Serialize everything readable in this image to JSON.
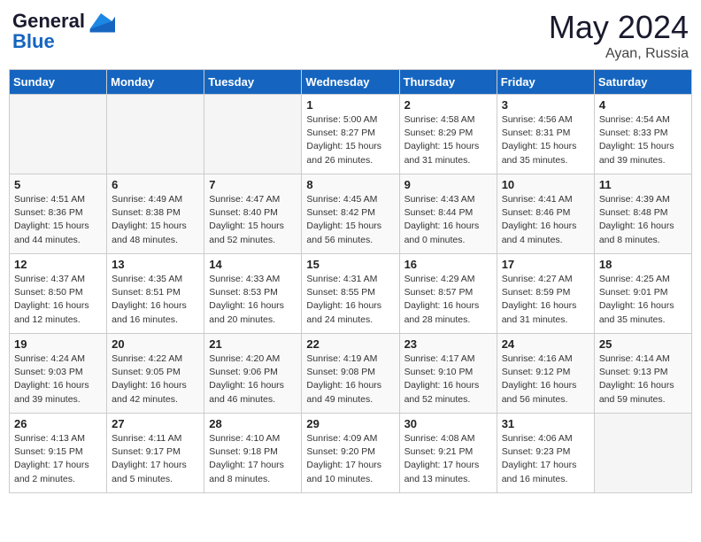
{
  "header": {
    "logo_line1": "General",
    "logo_line2": "Blue",
    "month_year": "May 2024",
    "location": "Ayan, Russia"
  },
  "days_of_week": [
    "Sunday",
    "Monday",
    "Tuesday",
    "Wednesday",
    "Thursday",
    "Friday",
    "Saturday"
  ],
  "weeks": [
    [
      {
        "num": "",
        "sunrise": "",
        "sunset": "",
        "daylight": "",
        "empty": true
      },
      {
        "num": "",
        "sunrise": "",
        "sunset": "",
        "daylight": "",
        "empty": true
      },
      {
        "num": "",
        "sunrise": "",
        "sunset": "",
        "daylight": "",
        "empty": true
      },
      {
        "num": "1",
        "sunrise": "Sunrise: 5:00 AM",
        "sunset": "Sunset: 8:27 PM",
        "daylight": "Daylight: 15 hours and 26 minutes.",
        "empty": false
      },
      {
        "num": "2",
        "sunrise": "Sunrise: 4:58 AM",
        "sunset": "Sunset: 8:29 PM",
        "daylight": "Daylight: 15 hours and 31 minutes.",
        "empty": false
      },
      {
        "num": "3",
        "sunrise": "Sunrise: 4:56 AM",
        "sunset": "Sunset: 8:31 PM",
        "daylight": "Daylight: 15 hours and 35 minutes.",
        "empty": false
      },
      {
        "num": "4",
        "sunrise": "Sunrise: 4:54 AM",
        "sunset": "Sunset: 8:33 PM",
        "daylight": "Daylight: 15 hours and 39 minutes.",
        "empty": false
      }
    ],
    [
      {
        "num": "5",
        "sunrise": "Sunrise: 4:51 AM",
        "sunset": "Sunset: 8:36 PM",
        "daylight": "Daylight: 15 hours and 44 minutes.",
        "empty": false
      },
      {
        "num": "6",
        "sunrise": "Sunrise: 4:49 AM",
        "sunset": "Sunset: 8:38 PM",
        "daylight": "Daylight: 15 hours and 48 minutes.",
        "empty": false
      },
      {
        "num": "7",
        "sunrise": "Sunrise: 4:47 AM",
        "sunset": "Sunset: 8:40 PM",
        "daylight": "Daylight: 15 hours and 52 minutes.",
        "empty": false
      },
      {
        "num": "8",
        "sunrise": "Sunrise: 4:45 AM",
        "sunset": "Sunset: 8:42 PM",
        "daylight": "Daylight: 15 hours and 56 minutes.",
        "empty": false
      },
      {
        "num": "9",
        "sunrise": "Sunrise: 4:43 AM",
        "sunset": "Sunset: 8:44 PM",
        "daylight": "Daylight: 16 hours and 0 minutes.",
        "empty": false
      },
      {
        "num": "10",
        "sunrise": "Sunrise: 4:41 AM",
        "sunset": "Sunset: 8:46 PM",
        "daylight": "Daylight: 16 hours and 4 minutes.",
        "empty": false
      },
      {
        "num": "11",
        "sunrise": "Sunrise: 4:39 AM",
        "sunset": "Sunset: 8:48 PM",
        "daylight": "Daylight: 16 hours and 8 minutes.",
        "empty": false
      }
    ],
    [
      {
        "num": "12",
        "sunrise": "Sunrise: 4:37 AM",
        "sunset": "Sunset: 8:50 PM",
        "daylight": "Daylight: 16 hours and 12 minutes.",
        "empty": false
      },
      {
        "num": "13",
        "sunrise": "Sunrise: 4:35 AM",
        "sunset": "Sunset: 8:51 PM",
        "daylight": "Daylight: 16 hours and 16 minutes.",
        "empty": false
      },
      {
        "num": "14",
        "sunrise": "Sunrise: 4:33 AM",
        "sunset": "Sunset: 8:53 PM",
        "daylight": "Daylight: 16 hours and 20 minutes.",
        "empty": false
      },
      {
        "num": "15",
        "sunrise": "Sunrise: 4:31 AM",
        "sunset": "Sunset: 8:55 PM",
        "daylight": "Daylight: 16 hours and 24 minutes.",
        "empty": false
      },
      {
        "num": "16",
        "sunrise": "Sunrise: 4:29 AM",
        "sunset": "Sunset: 8:57 PM",
        "daylight": "Daylight: 16 hours and 28 minutes.",
        "empty": false
      },
      {
        "num": "17",
        "sunrise": "Sunrise: 4:27 AM",
        "sunset": "Sunset: 8:59 PM",
        "daylight": "Daylight: 16 hours and 31 minutes.",
        "empty": false
      },
      {
        "num": "18",
        "sunrise": "Sunrise: 4:25 AM",
        "sunset": "Sunset: 9:01 PM",
        "daylight": "Daylight: 16 hours and 35 minutes.",
        "empty": false
      }
    ],
    [
      {
        "num": "19",
        "sunrise": "Sunrise: 4:24 AM",
        "sunset": "Sunset: 9:03 PM",
        "daylight": "Daylight: 16 hours and 39 minutes.",
        "empty": false
      },
      {
        "num": "20",
        "sunrise": "Sunrise: 4:22 AM",
        "sunset": "Sunset: 9:05 PM",
        "daylight": "Daylight: 16 hours and 42 minutes.",
        "empty": false
      },
      {
        "num": "21",
        "sunrise": "Sunrise: 4:20 AM",
        "sunset": "Sunset: 9:06 PM",
        "daylight": "Daylight: 16 hours and 46 minutes.",
        "empty": false
      },
      {
        "num": "22",
        "sunrise": "Sunrise: 4:19 AM",
        "sunset": "Sunset: 9:08 PM",
        "daylight": "Daylight: 16 hours and 49 minutes.",
        "empty": false
      },
      {
        "num": "23",
        "sunrise": "Sunrise: 4:17 AM",
        "sunset": "Sunset: 9:10 PM",
        "daylight": "Daylight: 16 hours and 52 minutes.",
        "empty": false
      },
      {
        "num": "24",
        "sunrise": "Sunrise: 4:16 AM",
        "sunset": "Sunset: 9:12 PM",
        "daylight": "Daylight: 16 hours and 56 minutes.",
        "empty": false
      },
      {
        "num": "25",
        "sunrise": "Sunrise: 4:14 AM",
        "sunset": "Sunset: 9:13 PM",
        "daylight": "Daylight: 16 hours and 59 minutes.",
        "empty": false
      }
    ],
    [
      {
        "num": "26",
        "sunrise": "Sunrise: 4:13 AM",
        "sunset": "Sunset: 9:15 PM",
        "daylight": "Daylight: 17 hours and 2 minutes.",
        "empty": false
      },
      {
        "num": "27",
        "sunrise": "Sunrise: 4:11 AM",
        "sunset": "Sunset: 9:17 PM",
        "daylight": "Daylight: 17 hours and 5 minutes.",
        "empty": false
      },
      {
        "num": "28",
        "sunrise": "Sunrise: 4:10 AM",
        "sunset": "Sunset: 9:18 PM",
        "daylight": "Daylight: 17 hours and 8 minutes.",
        "empty": false
      },
      {
        "num": "29",
        "sunrise": "Sunrise: 4:09 AM",
        "sunset": "Sunset: 9:20 PM",
        "daylight": "Daylight: 17 hours and 10 minutes.",
        "empty": false
      },
      {
        "num": "30",
        "sunrise": "Sunrise: 4:08 AM",
        "sunset": "Sunset: 9:21 PM",
        "daylight": "Daylight: 17 hours and 13 minutes.",
        "empty": false
      },
      {
        "num": "31",
        "sunrise": "Sunrise: 4:06 AM",
        "sunset": "Sunset: 9:23 PM",
        "daylight": "Daylight: 17 hours and 16 minutes.",
        "empty": false
      },
      {
        "num": "",
        "sunrise": "",
        "sunset": "",
        "daylight": "",
        "empty": true
      }
    ]
  ]
}
